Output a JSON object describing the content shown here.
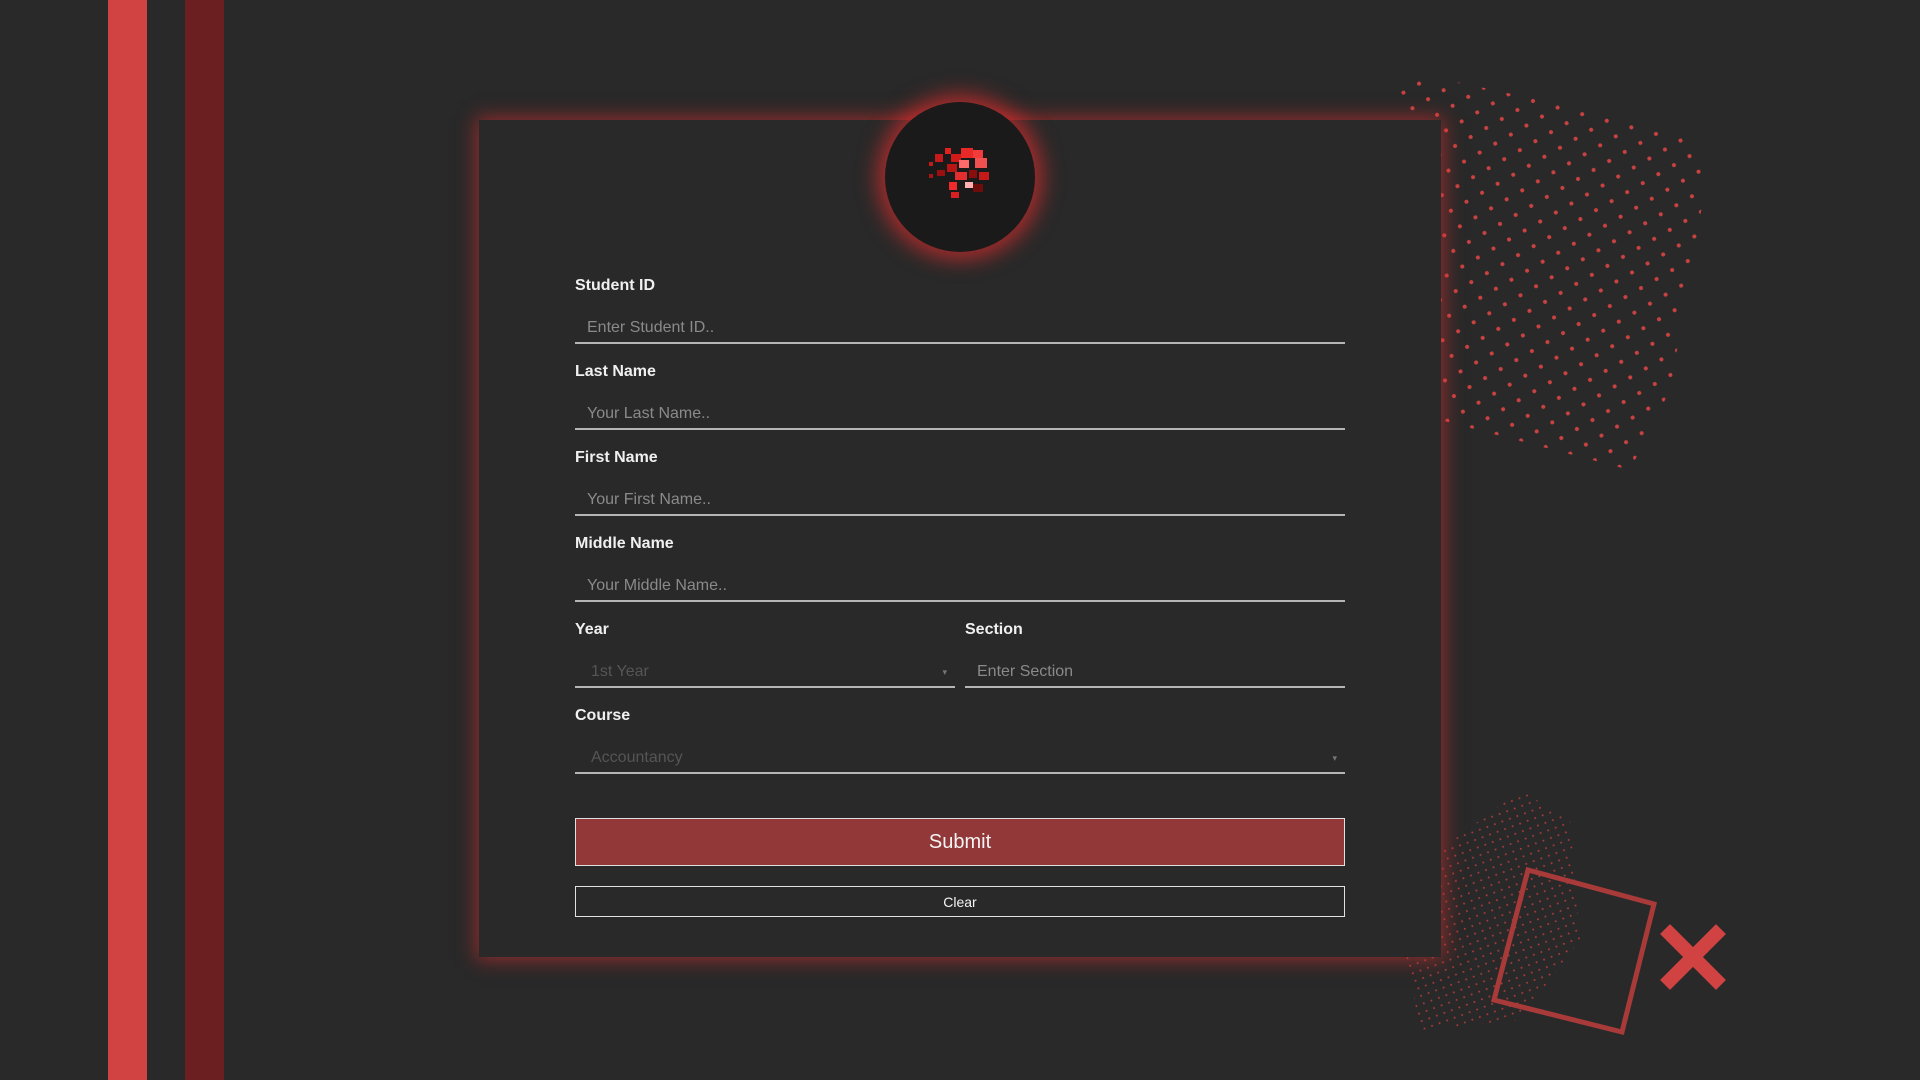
{
  "form": {
    "student_id": {
      "label": "Student ID",
      "placeholder": "Enter Student ID.."
    },
    "last_name": {
      "label": "Last Name",
      "placeholder": "Your Last Name.."
    },
    "first_name": {
      "label": "First Name",
      "placeholder": "Your First Name.."
    },
    "middle_name": {
      "label": "Middle Name",
      "placeholder": "Your Middle Name.."
    },
    "year": {
      "label": "Year",
      "value": "1st Year"
    },
    "section": {
      "label": "Section",
      "placeholder": "Enter Section"
    },
    "course": {
      "label": "Course",
      "value": "Accountancy"
    }
  },
  "buttons": {
    "submit_label": "Submit",
    "clear_label": "Clear"
  },
  "icons": {
    "select_arrow": "▾",
    "logo": "pixel-logo-icon",
    "close": "close-icon"
  },
  "colors": {
    "background": "#292929",
    "accent": "#d04342",
    "accent_dark": "#6b1f20",
    "submit_bg": "#923838",
    "glow": "#e22e2e"
  }
}
